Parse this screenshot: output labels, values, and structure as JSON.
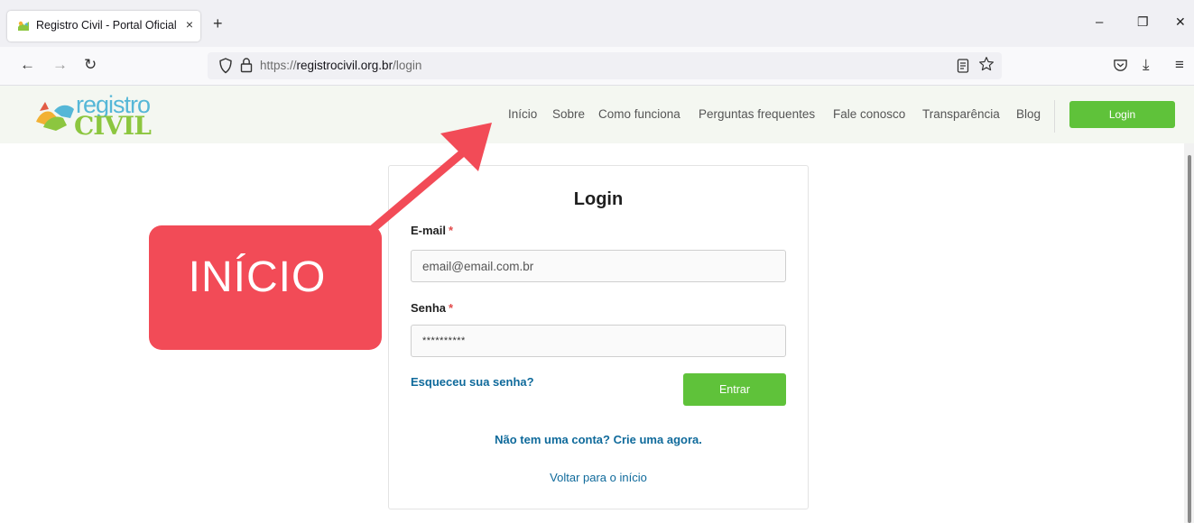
{
  "browser": {
    "tab_title": "Registro Civil - Portal Oficial",
    "tab_close_icon": "×",
    "new_tab_icon": "+",
    "url_prefix": "https://",
    "url_domain": "registrocivil.org.br",
    "url_path": "/login",
    "window_controls": [
      "–",
      "❐",
      "✕"
    ],
    "nav_icons": [
      "←",
      "→",
      "↻"
    ],
    "right_icons": [
      "⤓",
      "≡"
    ]
  },
  "site": {
    "logo_top": "registro",
    "logo_bottom": "CIVIL",
    "nav": [
      "Início",
      "Sobre",
      "Como funciona",
      "Perguntas frequentes",
      "Fale conosco",
      "Transparência",
      "Blog"
    ],
    "login_button": "Login",
    "brand_green": "#5fc23a",
    "link_blue": "#0f6a9b"
  },
  "login_form": {
    "title": "Login",
    "email_label": "E-mail",
    "email_placeholder": "email@email.com.br",
    "password_label": "Senha",
    "password_value": "**********",
    "required_marker": "*",
    "forgot_link": "Esqueceu sua senha?",
    "submit_button": "Entrar",
    "signup_link": "Não tem uma conta? Crie uma agora.",
    "back_link": "Voltar para o início"
  },
  "annotation": {
    "callout_text": "INÍCIO",
    "color": "#f24b57"
  }
}
